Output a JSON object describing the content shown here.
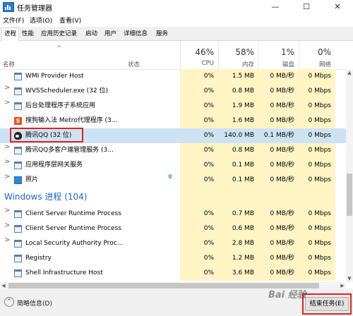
{
  "window": {
    "title": "任务管理器",
    "minimize": "—",
    "maximize": "☐",
    "close": "✕"
  },
  "menu": {
    "file": "文件(F)",
    "options": "选项(O)",
    "view": "查看(V)"
  },
  "tabs": [
    "进程",
    "性能",
    "应用历史记录",
    "启动",
    "用户",
    "详细信息",
    "服务"
  ],
  "columns": {
    "name": "名称",
    "status": "状态",
    "cpu": {
      "pct": "46%",
      "label": "CPU"
    },
    "memory": {
      "pct": "58%",
      "label": "内存"
    },
    "disk": {
      "pct": "1%",
      "label": "磁盘"
    },
    "network": {
      "pct": "0%",
      "label": "网络"
    }
  },
  "apps": [
    {
      "name": "WMI Provider Host",
      "icon": "window-icon",
      "expand": "",
      "cpu": "0%",
      "mem": "1.5 MB",
      "disk": "0 MB/秒",
      "net": "0 Mbps"
    },
    {
      "name": "WVSScheduler.exe (32 位)",
      "icon": "window-icon",
      "expand": ">",
      "cpu": "0%",
      "mem": "0.8 MB",
      "disk": "0 MB/秒",
      "net": "0 Mbps"
    },
    {
      "name": "后台处理程序子系统应用",
      "icon": "window-icon",
      "expand": ">",
      "cpu": "0%",
      "mem": "1.9 MB",
      "disk": "0 MB/秒",
      "net": "0 Mbps"
    },
    {
      "name": "搜狗输入法 Metro代理程序 (3...",
      "icon": "sogou-icon",
      "expand": "",
      "cpu": "0%",
      "mem": "1.6 MB",
      "disk": "0 MB/秒",
      "net": "0 Mbps"
    },
    {
      "name": "腾讯QQ (32 位)",
      "icon": "qq-icon",
      "expand": "",
      "cpu": "0%",
      "mem": "140.0 MB",
      "disk": "0.1 MB/秒",
      "net": "0 Mbps",
      "selected": true
    },
    {
      "name": "腾讯QQ多客户端管理服务 (3...",
      "icon": "window-icon",
      "expand": ">",
      "cpu": "0%",
      "mem": "0.8 MB",
      "disk": "0 MB/秒",
      "net": "0 Mbps"
    },
    {
      "name": "应用程序层网关服务",
      "icon": "window-icon",
      "expand": ">",
      "cpu": "0%",
      "mem": "0.1 MB",
      "disk": "0 MB/秒",
      "net": "0 Mbps"
    },
    {
      "name": "照片",
      "icon": "photo-icon",
      "expand": ">",
      "cpu": "0%",
      "mem": "0.1 MB",
      "disk": "0 MB/秒",
      "net": "0 Mbps",
      "leaf": true
    }
  ],
  "windows_group": "Windows 进程 (104)",
  "winprocs": [
    {
      "name": "Client Server Runtime Process",
      "expand": ">",
      "cpu": "0%",
      "mem": "0.7 MB",
      "disk": "0 MB/秒",
      "net": "0 Mbps"
    },
    {
      "name": "Client Server Runtime Process",
      "expand": ">",
      "cpu": "0%",
      "mem": "0.6 MB",
      "disk": "0 MB/秒",
      "net": "0 Mbps"
    },
    {
      "name": "Local Security Authority Proc...",
      "expand": ">",
      "cpu": "0%",
      "mem": "2.8 MB",
      "disk": "0 MB/秒",
      "net": "0 Mbps"
    },
    {
      "name": "Registry",
      "expand": "",
      "cpu": "0%",
      "mem": "1.2 MB",
      "disk": "0 MB/秒",
      "net": "0 Mbps"
    },
    {
      "name": "Shell Infrastructure Host",
      "expand": "",
      "cpu": "0%",
      "mem": "3.6 MB",
      "disk": "0 MB/秒",
      "net": "0 Mbps"
    }
  ],
  "footer": {
    "fewer_details": "简略信息(D)",
    "end_task": "结束任务(E)"
  },
  "watermark": "Bai 经验"
}
